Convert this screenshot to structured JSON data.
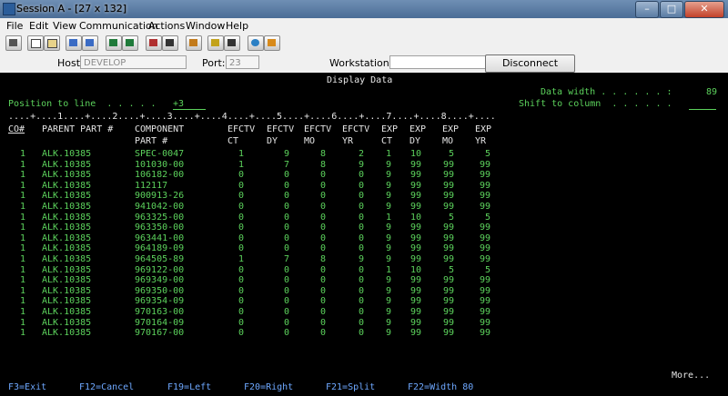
{
  "window": {
    "title": "Session A - [27 x 132]"
  },
  "menu": [
    "File",
    "Edit",
    "View",
    "Communication",
    "Actions",
    "Window",
    "Help"
  ],
  "host": {
    "host_label": "Host:",
    "host_value": "DEVELOP",
    "port_label": "Port:",
    "port_value": "23",
    "ws_label": "Workstation ID:",
    "ws_value": "",
    "disconnect": "Disconnect"
  },
  "screen": {
    "title": "Display Data",
    "data_width_label": "Data width . . . . . . :",
    "data_width_value": "89",
    "position_label": "Position to line  . . . . .",
    "position_value": "+3",
    "shift_label": "Shift to column  . . . . . .",
    "ruler": "....+....1....+....2....+....3....+....4....+....5....+....6....+....7....+....8....+....",
    "headers1": [
      "CO#",
      "PARENT PART #",
      "COMPONENT",
      "EFCTV",
      "EFCTV",
      "EFCTV",
      "EFCTV",
      "EXP",
      "EXP",
      "EXP",
      "EXP"
    ],
    "headers2": [
      "",
      "",
      "PART #",
      "CT",
      "DY",
      "MO",
      "YR",
      "CT",
      "DY",
      "MO",
      "YR"
    ],
    "rows": [
      [
        "1",
        "ALK.10385",
        "SPEC-0047",
        "1",
        "9",
        "8",
        "2",
        "1",
        "10",
        "5",
        "5"
      ],
      [
        "1",
        "ALK.10385",
        "101030-00",
        "1",
        "7",
        "8",
        "9",
        "9",
        "99",
        "99",
        "99"
      ],
      [
        "1",
        "ALK.10385",
        "106182-00",
        "0",
        "0",
        "0",
        "0",
        "9",
        "99",
        "99",
        "99"
      ],
      [
        "1",
        "ALK.10385",
        "112117",
        "0",
        "0",
        "0",
        "0",
        "9",
        "99",
        "99",
        "99"
      ],
      [
        "1",
        "ALK.10385",
        "900913-26",
        "0",
        "0",
        "0",
        "0",
        "9",
        "99",
        "99",
        "99"
      ],
      [
        "1",
        "ALK.10385",
        "941042-00",
        "0",
        "0",
        "0",
        "0",
        "9",
        "99",
        "99",
        "99"
      ],
      [
        "1",
        "ALK.10385",
        "963325-00",
        "0",
        "0",
        "0",
        "0",
        "1",
        "10",
        "5",
        "5"
      ],
      [
        "1",
        "ALK.10385",
        "963350-00",
        "0",
        "0",
        "0",
        "0",
        "9",
        "99",
        "99",
        "99"
      ],
      [
        "1",
        "ALK.10385",
        "963441-00",
        "0",
        "0",
        "0",
        "0",
        "9",
        "99",
        "99",
        "99"
      ],
      [
        "1",
        "ALK.10385",
        "964189-09",
        "0",
        "0",
        "0",
        "0",
        "9",
        "99",
        "99",
        "99"
      ],
      [
        "1",
        "ALK.10385",
        "964505-89",
        "1",
        "7",
        "8",
        "9",
        "9",
        "99",
        "99",
        "99"
      ],
      [
        "1",
        "ALK.10385",
        "969122-00",
        "0",
        "0",
        "0",
        "0",
        "1",
        "10",
        "5",
        "5"
      ],
      [
        "1",
        "ALK.10385",
        "969349-00",
        "0",
        "0",
        "0",
        "0",
        "9",
        "99",
        "99",
        "99"
      ],
      [
        "1",
        "ALK.10385",
        "969350-00",
        "0",
        "0",
        "0",
        "0",
        "9",
        "99",
        "99",
        "99"
      ],
      [
        "1",
        "ALK.10385",
        "969354-09",
        "0",
        "0",
        "0",
        "0",
        "9",
        "99",
        "99",
        "99"
      ],
      [
        "1",
        "ALK.10385",
        "970163-00",
        "0",
        "0",
        "0",
        "0",
        "9",
        "99",
        "99",
        "99"
      ],
      [
        "1",
        "ALK.10385",
        "970164-09",
        "0",
        "0",
        "0",
        "0",
        "9",
        "99",
        "99",
        "99"
      ],
      [
        "1",
        "ALK.10385",
        "970167-00",
        "0",
        "0",
        "0",
        "0",
        "9",
        "99",
        "99",
        "99"
      ]
    ],
    "more": "More...",
    "fkeys": [
      "F3=Exit",
      "F12=Cancel",
      "F19=Left",
      "F20=Right",
      "F21=Split",
      "F22=Width 80"
    ]
  }
}
